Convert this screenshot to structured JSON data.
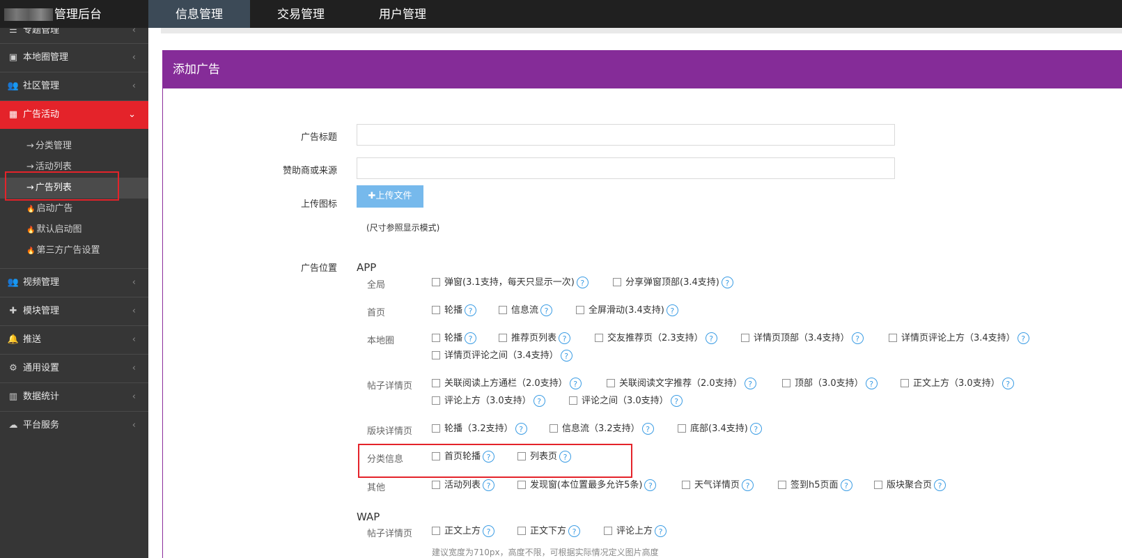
{
  "header": {
    "brand": "管理后台",
    "nav": [
      "信息管理",
      "交易管理",
      "用户管理"
    ],
    "active_nav": "信息管理"
  },
  "sidebar": {
    "menus_top": [
      {
        "icon": "list-icon",
        "label": "专题管理"
      },
      {
        "icon": "image-icon",
        "label": "本地圈管理"
      },
      {
        "icon": "users-icon",
        "label": "社区管理"
      }
    ],
    "active_menu": {
      "icon": "calendar-icon",
      "label": "广告活动"
    },
    "subitems": [
      {
        "prefix": "→",
        "label": "分类管理"
      },
      {
        "prefix": "→",
        "label": "活动列表"
      },
      {
        "prefix": "→",
        "label": "广告列表"
      },
      {
        "prefix": "🔥",
        "label": "启动广告"
      },
      {
        "prefix": "🔥",
        "label": "默认启动图"
      },
      {
        "prefix": "🔥",
        "label": "第三方广告设置"
      }
    ],
    "menus_bottom": [
      {
        "icon": "users-icon",
        "label": "视频管理"
      },
      {
        "icon": "puzzle-icon",
        "label": "模块管理"
      },
      {
        "icon": "bell-icon",
        "label": "推送"
      },
      {
        "icon": "gears-icon",
        "label": "通用设置"
      },
      {
        "icon": "bar-chart-icon",
        "label": "数据统计"
      },
      {
        "icon": "cloud-icon",
        "label": "平台服务"
      }
    ],
    "chevron": "‹",
    "chevron_open": "⌄"
  },
  "form": {
    "title": "添加广告",
    "ad_title_label": "广告标题",
    "sponsor_label": "赞助商或来源",
    "upload_label": "上传图标",
    "upload_button": "上传文件",
    "size_hint": "(尺寸参照显示模式)",
    "position_label": "广告位置",
    "app_title": "APP",
    "wap_title": "WAP",
    "help_glyph": "?",
    "rows": {
      "global": {
        "label": "全局",
        "options": [
          "弹窗(3.1支持，每天只显示一次)",
          "分享弹窗顶部(3.4支持)"
        ]
      },
      "home": {
        "label": "首页",
        "options": [
          "轮播",
          "信息流",
          "全屏滑动(3.4支持)"
        ]
      },
      "local": {
        "label": "本地圈",
        "options": [
          "轮播",
          "推荐页列表",
          "交友推荐页（2.3支持）",
          "详情页顶部（3.4支持）",
          "详情页评论上方（3.4支持）",
          "详情页评论之间（3.4支持）"
        ]
      },
      "post": {
        "label": "帖子详情页",
        "options": [
          "关联阅读上方通栏（2.0支持）",
          "关联阅读文字推荐（2.0支持）",
          "顶部（3.0支持）",
          "正文上方（3.0支持）",
          "评论上方（3.0支持）",
          "评论之间（3.0支持）"
        ]
      },
      "board": {
        "label": "版块详情页",
        "options": [
          "轮播（3.2支持）",
          "信息流（3.2支持）",
          "底部(3.4支持)"
        ]
      },
      "classified": {
        "label": "分类信息",
        "options": [
          "首页轮播",
          "列表页"
        ]
      },
      "other": {
        "label": "其他",
        "options": [
          "活动列表",
          "发现窗(本位置最多允许5条)",
          "天气详情页",
          "签到h5页面",
          "版块聚合页"
        ]
      },
      "wap_post": {
        "label": "帖子详情页",
        "options": [
          "正文上方",
          "正文下方",
          "评论上方"
        ]
      }
    },
    "wap_note": "建议宽度为710px，高度不限，可根据实际情况定义图片高度"
  },
  "colors": {
    "topbar": "#202020",
    "sidebar": "#363636",
    "active_menu": "#e4232a",
    "panel_header": "#852c98",
    "upload_button": "#76b9ec",
    "help_icon": "#3a9ce4",
    "highlight_box": "#e4232a"
  }
}
